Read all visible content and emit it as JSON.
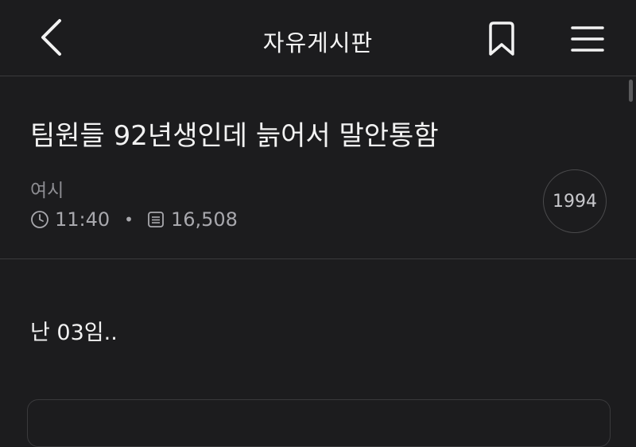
{
  "header": {
    "title": "자유게시판",
    "back_icon": "chevron-left-icon",
    "bookmark_icon": "bookmark-icon",
    "menu_icon": "hamburger-menu-icon"
  },
  "post": {
    "title": "팀원들 92년생인데 늙어서 말안통함",
    "author": "여시",
    "time": "11:40",
    "views": "16,508",
    "badge": "1994",
    "body": "난 03임.."
  },
  "colors": {
    "background": "#1c1c1e",
    "text": "#f2f2f2",
    "muted": "#8e8e93",
    "divider": "#3a3a3c"
  }
}
